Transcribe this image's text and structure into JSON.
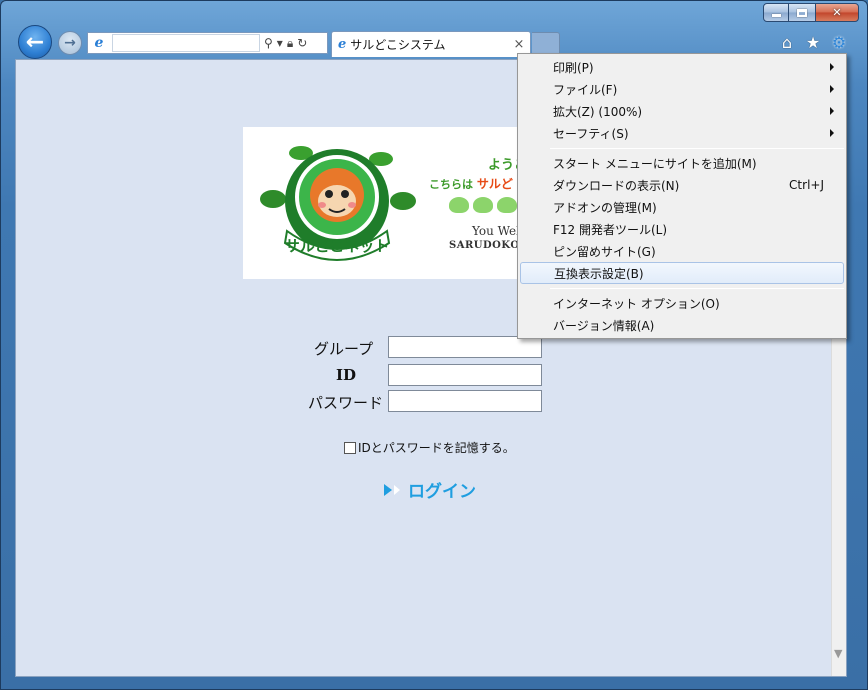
{
  "window": {
    "caption_buttons": [
      "minimize-icon",
      "maximize-icon",
      "close-icon"
    ],
    "close_glyph": "✕"
  },
  "nav": {
    "back_glyph": "←",
    "forward_glyph": "→",
    "address_value": "",
    "address_icons": [
      "search-icon",
      "dropdown-icon",
      "lock-icon",
      "refresh-icon"
    ]
  },
  "tab": {
    "title": "サルどこシステム",
    "close_glyph": "×"
  },
  "toolbar": {
    "home_glyph": "⌂",
    "favorites_glyph": "★",
    "tools_glyph": "⚙"
  },
  "logo": {
    "line1": "ようこ",
    "line2_prefix": "こちらは",
    "line2_brand": "サルど",
    "line3": "You Wel",
    "line4": "SARUDOKO",
    "badge_text": "サルどこネット"
  },
  "form": {
    "group_label": "グループ",
    "id_label": "ID",
    "password_label": "パスワード",
    "group_value": "",
    "id_value": "",
    "password_value": "",
    "remember_label": "IDとパスワードを記憶する。",
    "login_label": "ログイン"
  },
  "menu": {
    "items": [
      {
        "label": "印刷(P)",
        "accel": "",
        "submenu": true
      },
      {
        "label": "ファイル(F)",
        "accel": "",
        "submenu": true
      },
      {
        "label": "拡大(Z) (100%)",
        "accel": "",
        "submenu": true
      },
      {
        "label": "セーフティ(S)",
        "accel": "",
        "submenu": true
      },
      {
        "label": "スタート メニューにサイトを追加(M)",
        "accel": "",
        "submenu": false
      },
      {
        "label": "ダウンロードの表示(N)",
        "accel": "Ctrl+J",
        "submenu": false
      },
      {
        "label": "アドオンの管理(M)",
        "accel": "",
        "submenu": false
      },
      {
        "label": "F12 開発者ツール(L)",
        "accel": "",
        "submenu": false
      },
      {
        "label": "ピン留めサイト(G)",
        "accel": "",
        "submenu": false
      },
      {
        "label": "互換表示設定(B)",
        "accel": "",
        "submenu": false
      },
      {
        "label": "インターネット オプション(O)",
        "accel": "",
        "submenu": false
      },
      {
        "label": "バージョン情報(A)",
        "accel": "",
        "submenu": false
      }
    ]
  },
  "colors": {
    "login_accent": "#1f9ee0",
    "logo_green": "#3c9a2a",
    "logo_orange": "#e74b17",
    "content_bg": "#dae3f2"
  }
}
